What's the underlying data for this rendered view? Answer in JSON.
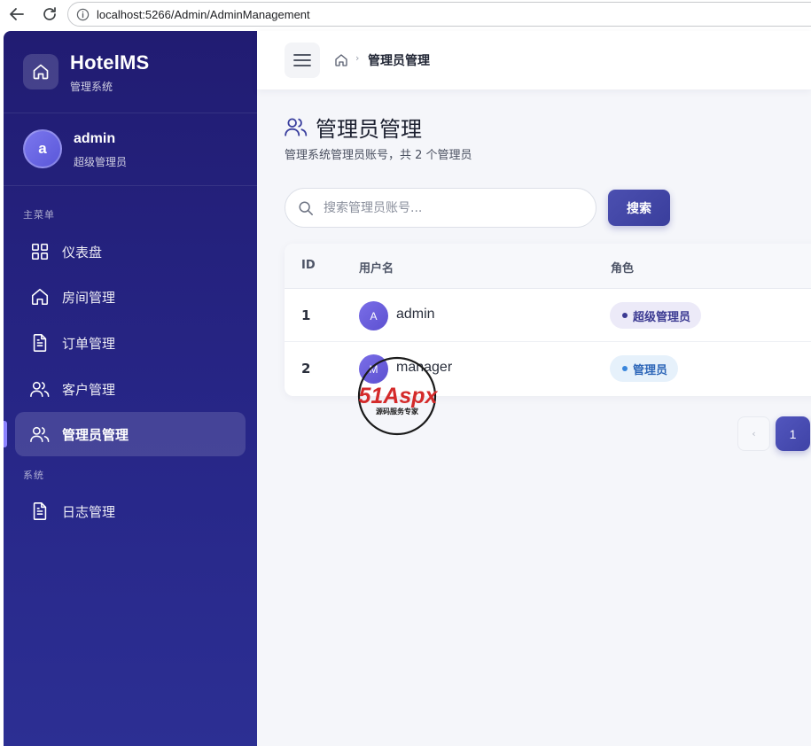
{
  "browser": {
    "url": "localhost:5266/Admin/AdminManagement"
  },
  "sidebar": {
    "brand_name": "HotelMS",
    "brand_sub": "管理系统",
    "user": {
      "avatar_letter": "a",
      "name": "admin",
      "role": "超级管理员"
    },
    "section_main": "主菜单",
    "section_system": "系统",
    "items": [
      {
        "label": "仪表盘",
        "icon": "dashboard-icon"
      },
      {
        "label": "房间管理",
        "icon": "home-icon"
      },
      {
        "label": "订单管理",
        "icon": "document-icon"
      },
      {
        "label": "客户管理",
        "icon": "users-icon"
      },
      {
        "label": "管理员管理",
        "icon": "users-icon",
        "active": true
      },
      {
        "label": "日志管理",
        "icon": "document-icon"
      }
    ]
  },
  "topbar": {
    "breadcrumb_current": "管理员管理"
  },
  "page": {
    "title": "管理员管理",
    "description": "管理系统管理员账号，共 2 个管理员"
  },
  "search": {
    "placeholder": "搜索管理员账号...",
    "value": "",
    "button_label": "搜索"
  },
  "table": {
    "columns": [
      "ID",
      "用户名",
      "角色"
    ],
    "rows": [
      {
        "id": "1",
        "avatar": "A",
        "username": "admin",
        "role": "超级管理员",
        "role_color": "#3b3a92"
      },
      {
        "id": "2",
        "avatar": "M",
        "username": "manager",
        "role": "管理员",
        "role_color": "#2d66b8"
      }
    ]
  },
  "pagination": {
    "prev_label": "‹",
    "current_page": "1"
  },
  "watermark": {
    "brand_text": "51Aspx",
    "tagline": "源码服务专家"
  },
  "colors": {
    "sidebar": "#272687",
    "accent": "#4b4fb0",
    "background": "#f5f6fa"
  }
}
